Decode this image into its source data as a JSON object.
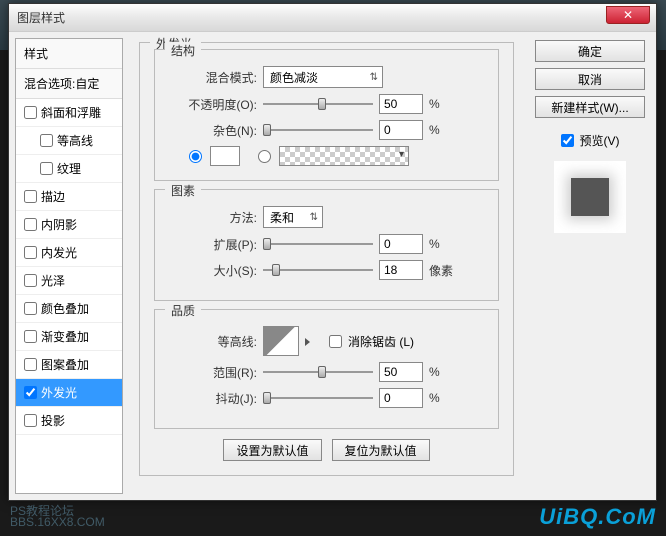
{
  "window": {
    "title": "图层样式"
  },
  "sidebar": {
    "header": "样式",
    "subheader": "混合选项:自定",
    "items": [
      {
        "label": "斜面和浮雕",
        "checked": false,
        "indent": false
      },
      {
        "label": "等高线",
        "checked": false,
        "indent": true
      },
      {
        "label": "纹理",
        "checked": false,
        "indent": true
      },
      {
        "label": "描边",
        "checked": false,
        "indent": false
      },
      {
        "label": "内阴影",
        "checked": false,
        "indent": false
      },
      {
        "label": "内发光",
        "checked": false,
        "indent": false
      },
      {
        "label": "光泽",
        "checked": false,
        "indent": false
      },
      {
        "label": "颜色叠加",
        "checked": false,
        "indent": false
      },
      {
        "label": "渐变叠加",
        "checked": false,
        "indent": false
      },
      {
        "label": "图案叠加",
        "checked": false,
        "indent": false
      },
      {
        "label": "外发光",
        "checked": true,
        "indent": false,
        "active": true
      },
      {
        "label": "投影",
        "checked": false,
        "indent": false
      }
    ]
  },
  "panel": {
    "title": "外发光",
    "structure": {
      "title": "结构",
      "blend_label": "混合模式:",
      "blend_value": "颜色减淡",
      "opacity_label": "不透明度(O):",
      "opacity_value": "50",
      "opacity_unit": "%",
      "noise_label": "杂色(N):",
      "noise_value": "0",
      "noise_unit": "%"
    },
    "elements": {
      "title": "图素",
      "technique_label": "方法:",
      "technique_value": "柔和",
      "spread_label": "扩展(P):",
      "spread_value": "0",
      "spread_unit": "%",
      "size_label": "大小(S):",
      "size_value": "18",
      "size_unit": "像素"
    },
    "quality": {
      "title": "品质",
      "contour_label": "等高线:",
      "antialias_label": "消除锯齿 (L)",
      "range_label": "范围(R):",
      "range_value": "50",
      "range_unit": "%",
      "jitter_label": "抖动(J):",
      "jitter_value": "0",
      "jitter_unit": "%"
    },
    "defaults": {
      "make": "设置为默认值",
      "reset": "复位为默认值"
    }
  },
  "rightcol": {
    "ok": "确定",
    "cancel": "取消",
    "newstyle": "新建样式(W)...",
    "preview_label": "预览(V)"
  },
  "watermark": {
    "line1": "PS教程论坛",
    "line2": "BBS.16XX8.COM",
    "brand": "UiBQ.CoM"
  }
}
